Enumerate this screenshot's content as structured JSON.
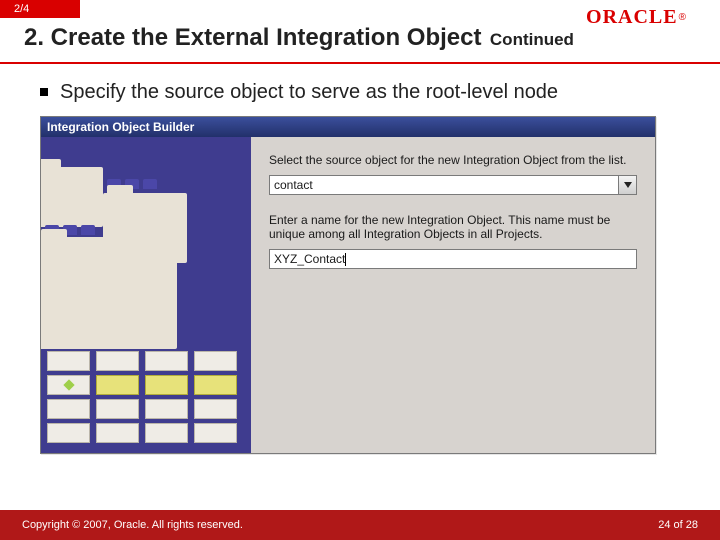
{
  "header": {
    "progress": "2/4",
    "logo_text": "ORACLE",
    "logo_reg": "®"
  },
  "title": {
    "main": "2. Create the External Integration Object",
    "continued": "Continued"
  },
  "bullet": {
    "text": "Specify the source object to serve as the root-level node"
  },
  "dialog": {
    "title": "Integration Object Builder",
    "instruction1": "Select the source object for the new Integration Object from the list.",
    "dropdown_value": "contact",
    "instruction2": "Enter a name for the new Integration Object. This name must be unique among all Integration Objects in all Projects.",
    "input_value": "XYZ_Contact"
  },
  "footer": {
    "copyright": "Copyright © 2007, Oracle. All rights reserved.",
    "page": "24 of 28"
  }
}
